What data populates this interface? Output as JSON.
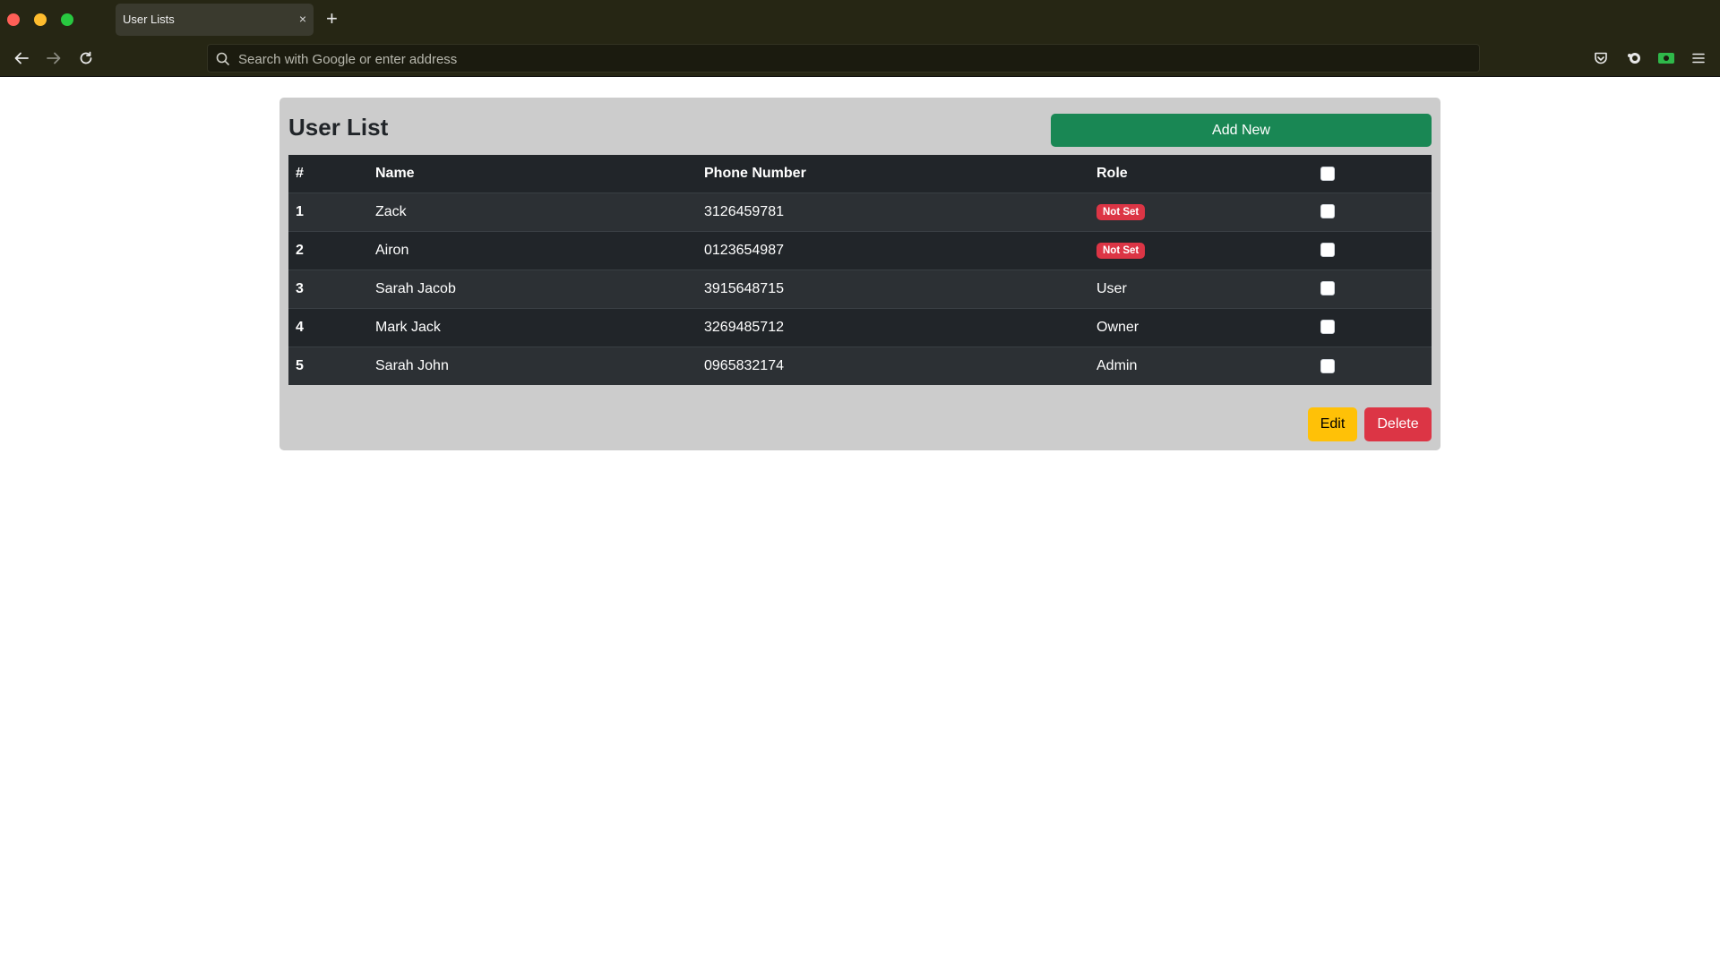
{
  "browser": {
    "tab_title": "User Lists",
    "tab_close_glyph": "×",
    "new_tab_glyph": "+",
    "address_placeholder": "Search with Google or enter address",
    "icons": [
      "back-arrow-icon",
      "forward-arrow-icon",
      "reload-icon",
      "search-icon",
      "pocket-icon",
      "extension-icon",
      "extension-green-icon",
      "hamburger-menu-icon"
    ]
  },
  "page": {
    "title": "User List",
    "add_button": "Add New",
    "edit_button": "Edit",
    "delete_button": "Delete"
  },
  "table": {
    "headers": {
      "num": "#",
      "name": "Name",
      "phone": "Phone Number",
      "role": "Role"
    },
    "rows": [
      {
        "num": "1",
        "name": "Zack",
        "phone": "3126459781",
        "role": "Not Set",
        "role_badge": true
      },
      {
        "num": "2",
        "name": "Airon",
        "phone": "0123654987",
        "role": "Not Set",
        "role_badge": true
      },
      {
        "num": "3",
        "name": "Sarah Jacob",
        "phone": "3915648715",
        "role": "User",
        "role_badge": false
      },
      {
        "num": "4",
        "name": "Mark Jack",
        "phone": "3269485712",
        "role": "Owner",
        "role_badge": false
      },
      {
        "num": "5",
        "name": "Sarah John",
        "phone": "0965832174",
        "role": "Admin",
        "role_badge": false
      }
    ]
  },
  "colors": {
    "add_button": "#198754",
    "edit_button": "#ffc107",
    "delete_button": "#dc3545",
    "badge_not_set": "#dc3545",
    "table_bg": "#212529",
    "card_bg": "#cccccc"
  }
}
